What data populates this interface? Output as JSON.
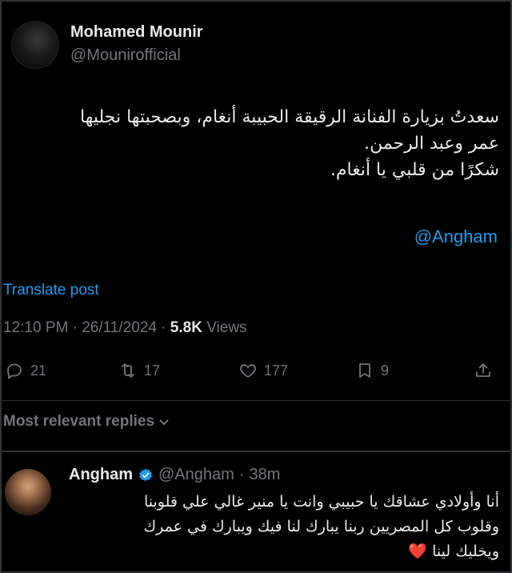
{
  "author": {
    "name": "Mohamed Mounir",
    "handle": "@Mounirofficial"
  },
  "tweet": {
    "lines": [
      "سعدتُ بزيارة الفنانة الرقيقة الحبيبة أنغام، وبصحبتها نجليها",
      "عمر وعبد الرحمن.",
      "شكرًا من قلبي يا أنغام."
    ],
    "mention": "@Angham",
    "translate_label": "Translate post",
    "time": "12:10 PM",
    "date": "26/11/2024",
    "views_count": "5.8K",
    "views_label": "Views"
  },
  "actions": {
    "replies": "21",
    "reposts": "17",
    "likes": "177",
    "bookmarks": "9"
  },
  "replies_filter": "Most relevant replies",
  "reply": {
    "name": "Angham",
    "handle": "@Angham",
    "age": "38m",
    "lines": [
      "أنا وأولادي عشاقك يا حبيبي وانت يا منير غالي علي قلوبنا",
      "وقلوب كل المصريين  ربنا يبارك لنا فيك ويبارك في عمرك",
      "ويخليك لينا"
    ],
    "emoji": "❤️"
  }
}
